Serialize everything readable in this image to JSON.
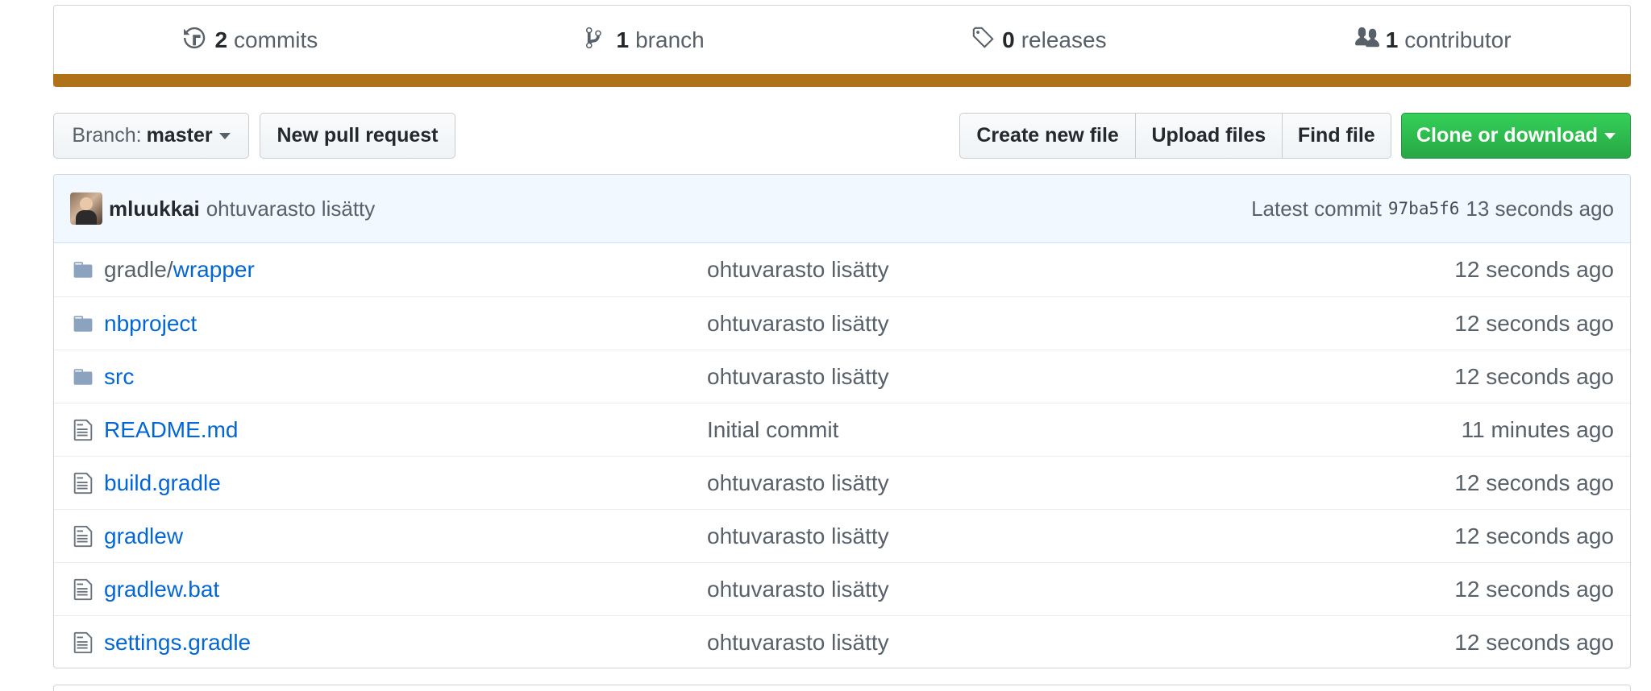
{
  "colors": {
    "language_bar": "#b07219",
    "link": "#0366d6",
    "clone_button": "#28a745"
  },
  "summary": [
    {
      "icon": "history-icon",
      "count": "2",
      "label": "commits"
    },
    {
      "icon": "git-branch-icon",
      "count": "1",
      "label": "branch"
    },
    {
      "icon": "tag-icon",
      "count": "0",
      "label": "releases"
    },
    {
      "icon": "people-icon",
      "count": "1",
      "label": "contributor"
    }
  ],
  "toolbar": {
    "branch_label": "Branch:",
    "branch_value": "master",
    "new_pr": "New pull request",
    "create_file": "Create new file",
    "upload_files": "Upload files",
    "find_file": "Find file",
    "clone": "Clone or download"
  },
  "commit": {
    "author": "mluukkai",
    "message": "ohtuvarasto lisätty",
    "latest_label": "Latest commit",
    "sha": "97ba5f6",
    "age": "13 seconds ago"
  },
  "files": [
    {
      "type": "dir",
      "prefix": "gradle/",
      "name": "wrapper",
      "message": "ohtuvarasto lisätty",
      "age": "12 seconds ago"
    },
    {
      "type": "dir",
      "prefix": "",
      "name": "nbproject",
      "message": "ohtuvarasto lisätty",
      "age": "12 seconds ago"
    },
    {
      "type": "dir",
      "prefix": "",
      "name": "src",
      "message": "ohtuvarasto lisätty",
      "age": "12 seconds ago"
    },
    {
      "type": "file",
      "prefix": "",
      "name": "README.md",
      "message": "Initial commit",
      "age": "11 minutes ago"
    },
    {
      "type": "file",
      "prefix": "",
      "name": "build.gradle",
      "message": "ohtuvarasto lisätty",
      "age": "12 seconds ago"
    },
    {
      "type": "file",
      "prefix": "",
      "name": "gradlew",
      "message": "ohtuvarasto lisätty",
      "age": "12 seconds ago"
    },
    {
      "type": "file",
      "prefix": "",
      "name": "gradlew.bat",
      "message": "ohtuvarasto lisätty",
      "age": "12 seconds ago"
    },
    {
      "type": "file",
      "prefix": "",
      "name": "settings.gradle",
      "message": "ohtuvarasto lisätty",
      "age": "12 seconds ago"
    }
  ]
}
